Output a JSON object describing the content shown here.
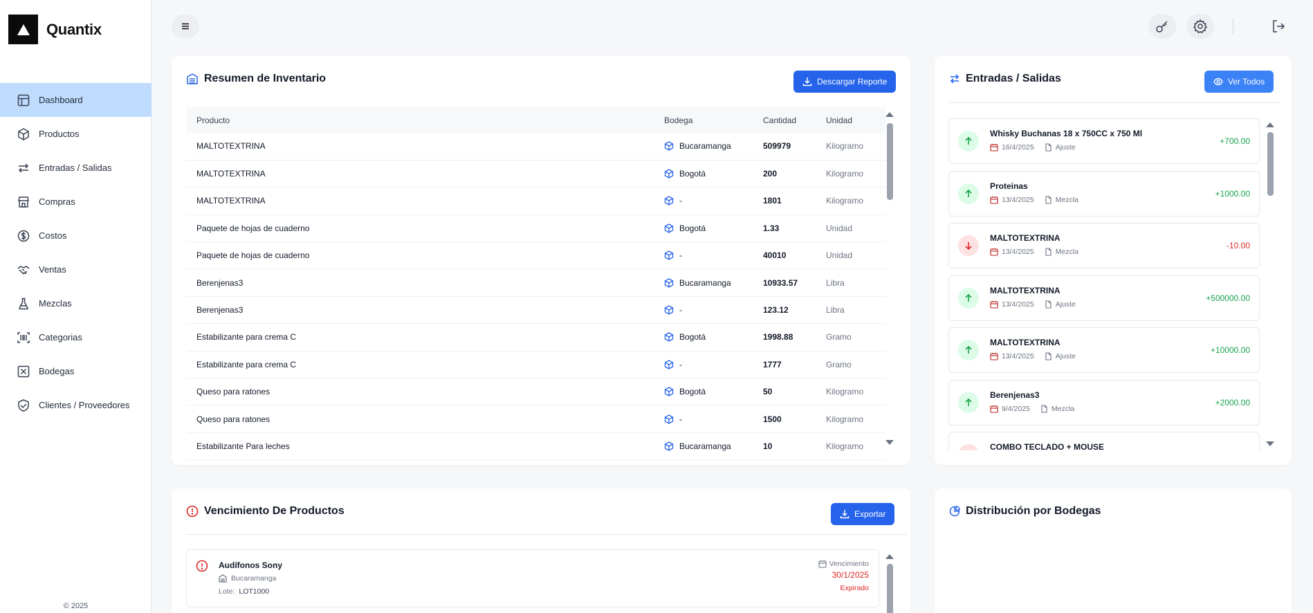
{
  "app": {
    "name": "Quantix",
    "copyright": "© 2025"
  },
  "sidebar": {
    "items": [
      {
        "label": "Dashboard",
        "icon": "layout-icon",
        "active": true
      },
      {
        "label": "Productos",
        "icon": "box-icon"
      },
      {
        "label": "Entradas / Salidas",
        "icon": "arrows-exchange-icon"
      },
      {
        "label": "Compras",
        "icon": "store-icon"
      },
      {
        "label": "Costos",
        "icon": "dollar-circle-icon"
      },
      {
        "label": "Ventas",
        "icon": "handshake-icon"
      },
      {
        "label": "Mezclas",
        "icon": "flask-icon"
      },
      {
        "label": "Categorias",
        "icon": "barcode-icon"
      },
      {
        "label": "Bodegas",
        "icon": "square-x-icon"
      },
      {
        "label": "Clientes / Proveedores",
        "icon": "handshake-shield-icon"
      }
    ]
  },
  "topbar": {
    "icons": [
      "menu-icon",
      "key-icon",
      "settings-icon",
      "logout-icon"
    ]
  },
  "inventory": {
    "title": "Resumen de Inventario",
    "download_label": "Descargar Reporte",
    "columns": [
      "Producto",
      "Bodega",
      "Cantidad",
      "Unidad"
    ],
    "rows": [
      [
        "MALTOTEXTRINA",
        "Bucaramanga",
        "509979",
        "Kilogramo"
      ],
      [
        "MALTOTEXTRINA",
        "Bogotá",
        "200",
        "Kilogramo"
      ],
      [
        "MALTOTEXTRINA",
        "-",
        "1801",
        "Kilogramo"
      ],
      [
        "Paquete de hojas de cuaderno",
        "Bogotá",
        "1.33",
        "Unidad"
      ],
      [
        "Paquete de hojas de cuaderno",
        "-",
        "40010",
        "Unidad"
      ],
      [
        "Berenjenas3",
        "Bucaramanga",
        "10933.57",
        "Libra"
      ],
      [
        "Berenjenas3",
        "-",
        "123.12",
        "Libra"
      ],
      [
        "Estabilizante para crema C",
        "Bogotá",
        "1998.88",
        "Gramo"
      ],
      [
        "Estabilizante para crema C",
        "-",
        "1777",
        "Gramo"
      ],
      [
        "Queso para ratones",
        "Bogotá",
        "50",
        "Kilogramo"
      ],
      [
        "Queso para ratones",
        "-",
        "1500",
        "Kilogramo"
      ],
      [
        "Estabilizante Para leches",
        "Bucaramanga",
        "10",
        "Kilogramo"
      ]
    ]
  },
  "movements": {
    "title": "Entradas / Salidas",
    "view_all_label": "Ver Todos",
    "items": [
      {
        "name": "Whisky Buchanas 18 x 750CC x 750 Ml",
        "date": "16/4/2025",
        "type": "Ajuste",
        "qty": "+700.00",
        "direction": "in"
      },
      {
        "name": "Proteinas",
        "date": "13/4/2025",
        "type": "Mezcla",
        "qty": "+1000.00",
        "direction": "in"
      },
      {
        "name": "MALTOTEXTRINA",
        "date": "13/4/2025",
        "type": "Mezcla",
        "qty": "-10.00",
        "direction": "out"
      },
      {
        "name": "MALTOTEXTRINA",
        "date": "13/4/2025",
        "type": "Ajuste",
        "qty": "+500000.00",
        "direction": "in"
      },
      {
        "name": "MALTOTEXTRINA",
        "date": "13/4/2025",
        "type": "Ajuste",
        "qty": "+10000.00",
        "direction": "in"
      },
      {
        "name": "Berenjenas3",
        "date": "9/4/2025",
        "type": "Mezcla",
        "qty": "+2000.00",
        "direction": "in"
      },
      {
        "name": "COMBO TECLADO + MOUSE",
        "date": "",
        "type": "",
        "qty": "",
        "direction": "out"
      }
    ]
  },
  "expiry": {
    "title": "Vencimiento De Productos",
    "export_label": "Exportar",
    "items": [
      {
        "name": "Audífonos Sony",
        "warehouse": "Bucaramanga",
        "lot_label": "Lote:",
        "lot": "LOT1000",
        "due_label": "Vencimiento",
        "due_date": "30/1/2025",
        "status": "Expirado"
      }
    ]
  },
  "distribution": {
    "title": "Distribución por Bodegas"
  },
  "colors": {
    "primary": "#2563eb",
    "active_nav": "#bfdbfe",
    "positive": "#16a34a",
    "negative": "#dc2626"
  }
}
